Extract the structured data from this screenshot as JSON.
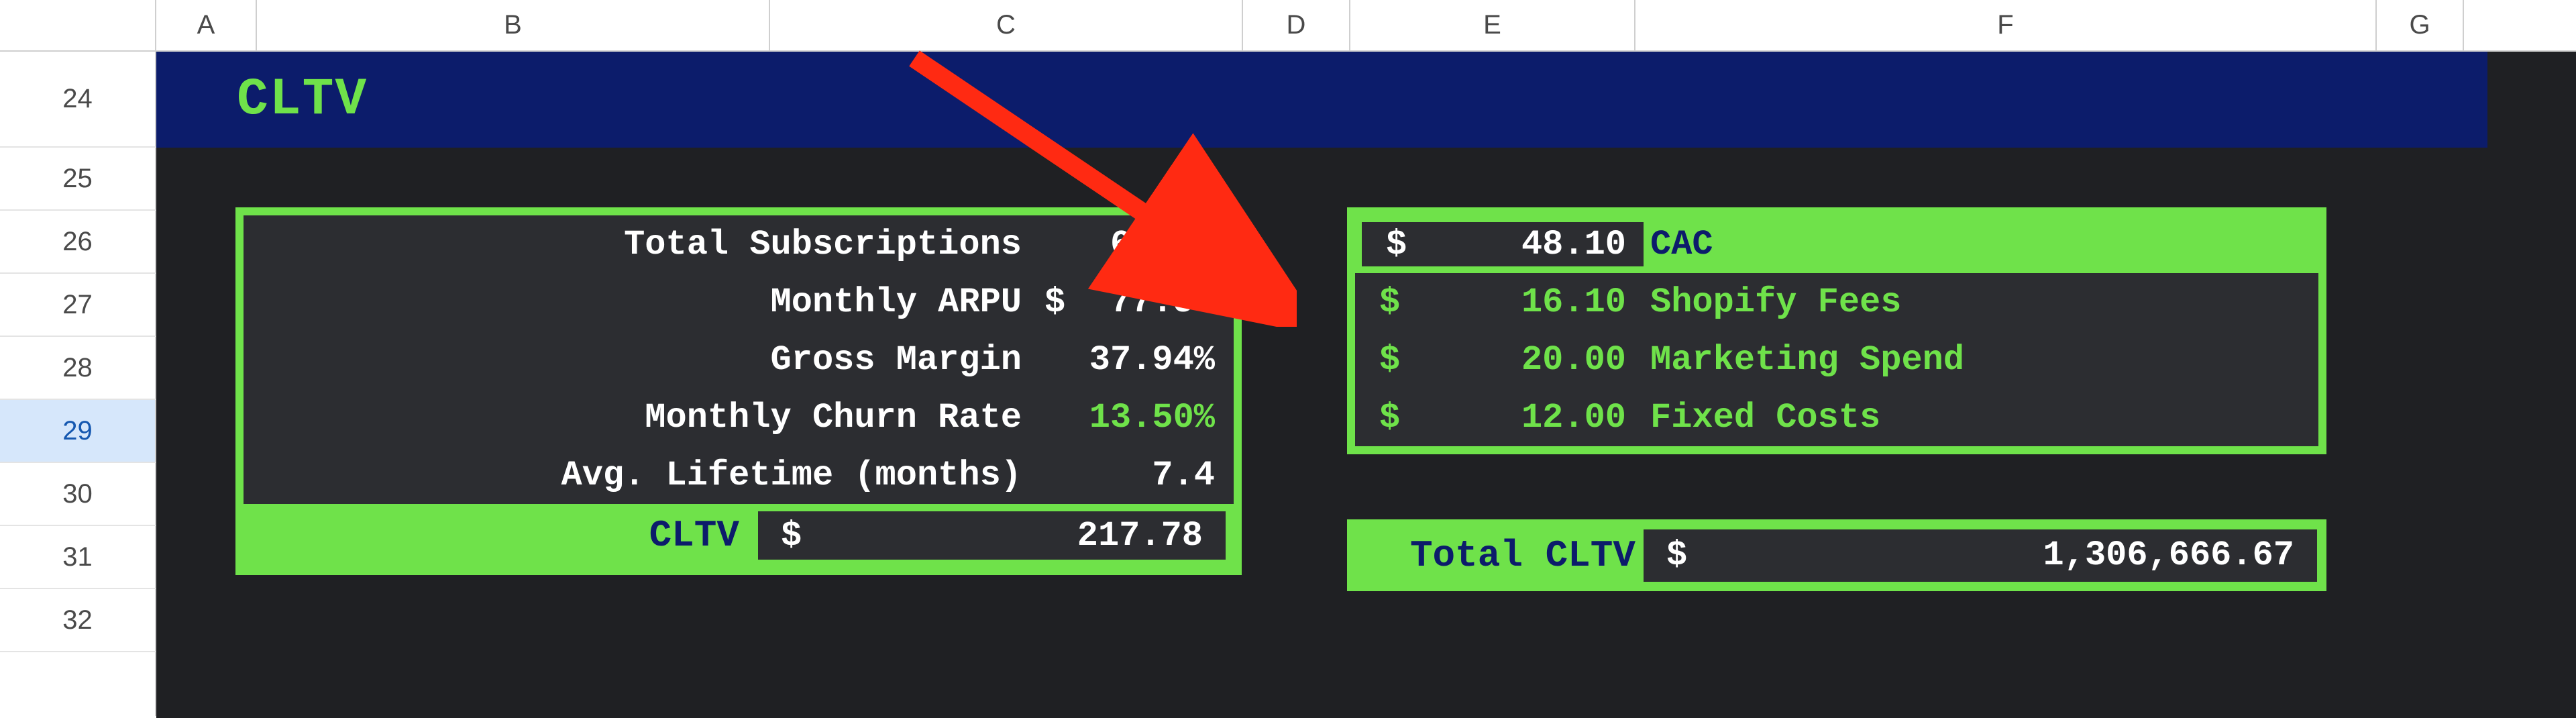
{
  "columns": [
    "A",
    "B",
    "C",
    "D",
    "E",
    "F",
    "G"
  ],
  "rows": [
    "24",
    "25",
    "26",
    "27",
    "28",
    "29",
    "30",
    "31",
    "32"
  ],
  "selected_row": "29",
  "title": "CLTV",
  "metrics": {
    "total_subscriptions": {
      "label": "Total Subscriptions",
      "value": "6,000"
    },
    "monthly_arpu": {
      "label": "Monthly ARPU",
      "symbol": "$",
      "value": "77.50"
    },
    "gross_margin": {
      "label": "Gross Margin",
      "value": "37.94%"
    },
    "monthly_churn": {
      "label": "Monthly Churn Rate",
      "value": "13.50%"
    },
    "avg_lifetime": {
      "label": "Avg. Lifetime (months)",
      "value": "7.4"
    },
    "cltv": {
      "label": "CLTV",
      "symbol": "$",
      "value": "217.78"
    }
  },
  "cac_box": {
    "cac": {
      "symbol": "$",
      "amount": "48.10",
      "label": "CAC"
    },
    "rows": [
      {
        "symbol": "$",
        "amount": "16.10",
        "label": "Shopify Fees"
      },
      {
        "symbol": "$",
        "amount": "20.00",
        "label": "Marketing Spend"
      },
      {
        "symbol": "$",
        "amount": "12.00",
        "label": "Fixed Costs"
      }
    ]
  },
  "total_cltv": {
    "label": "Total CLTV",
    "symbol": "$",
    "value": "1,306,666.67"
  },
  "arrow": {
    "color": "#ff2a12"
  }
}
